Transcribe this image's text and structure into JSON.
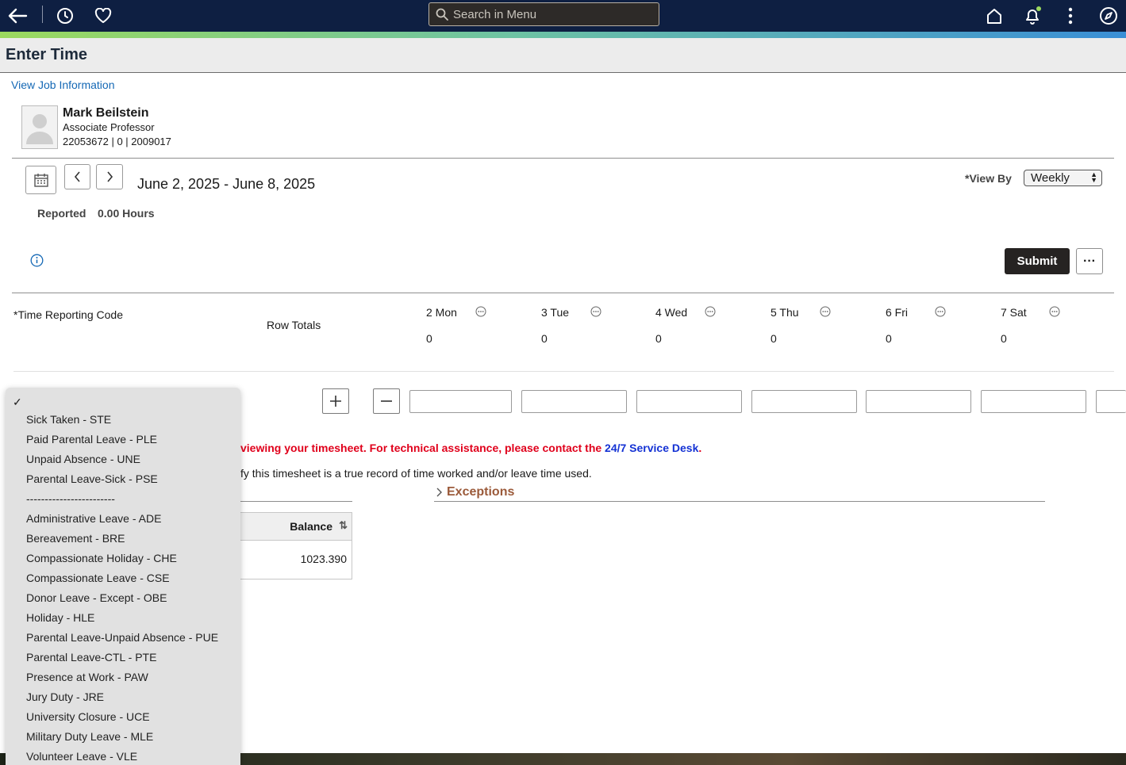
{
  "topbar": {
    "search_placeholder": "Search in Menu",
    "icons": [
      "back-arrow-icon",
      "history-icon",
      "favorites-heart-icon",
      "home-icon",
      "notifications-bell-icon",
      "kebab-menu-icon",
      "navigator-compass-icon"
    ]
  },
  "page": {
    "title": "Enter Time",
    "view_job_link": "View Job Information"
  },
  "employee": {
    "name": "Mark Beilstein",
    "title": "Associate Professor",
    "ids": "22053672 | 0 | 2009017"
  },
  "period": {
    "range": "June 2, 2025 - June 8, 2025",
    "view_by_label": "*View By",
    "view_by_value": "Weekly",
    "reported_label": "Reported",
    "reported_value": "0.00 Hours"
  },
  "actions": {
    "submit": "Submit",
    "more": "···"
  },
  "grid": {
    "trc_header": "*Time Reporting Code",
    "row_totals_header": "Row Totals",
    "days": [
      {
        "label": "2 Mon",
        "total": "0"
      },
      {
        "label": "3 Tue",
        "total": "0"
      },
      {
        "label": "4 Wed",
        "total": "0"
      },
      {
        "label": "5 Thu",
        "total": "0"
      },
      {
        "label": "6 Fri",
        "total": "0"
      },
      {
        "label": "7 Sat",
        "total": "0"
      }
    ]
  },
  "notice": {
    "warning_text": "viewing your timesheet. For technical assistance, please contact the ",
    "service_desk": "24/7 Service Desk",
    "warning_end": ".",
    "certify_text": "fy this timesheet is a true record of time worked and/or leave time used.",
    "exceptions": "Exceptions"
  },
  "balance": {
    "header": "Balance",
    "sort_icon": "⇅",
    "value": "1023.390"
  },
  "dropdown": {
    "checkmark": "✓",
    "items": [
      "Sick Taken - STE",
      "Paid Parental Leave - PLE",
      "Unpaid Absence - UNE",
      "Parental Leave-Sick - PSE",
      "------------------------",
      "Administrative Leave - ADE",
      "Bereavement - BRE",
      "Compassionate Holiday - CHE",
      "Compassionate Leave - CSE",
      "Donor Leave - Except - OBE",
      "Holiday - HLE",
      "Parental Leave-Unpaid Absence - PUE",
      "Parental Leave-CTL - PTE",
      "Presence at Work - PAW",
      "Jury Duty - JRE",
      "University Closure - UCE",
      "Military Duty Leave - MLE",
      "Volunteer Leave - VLE"
    ]
  }
}
